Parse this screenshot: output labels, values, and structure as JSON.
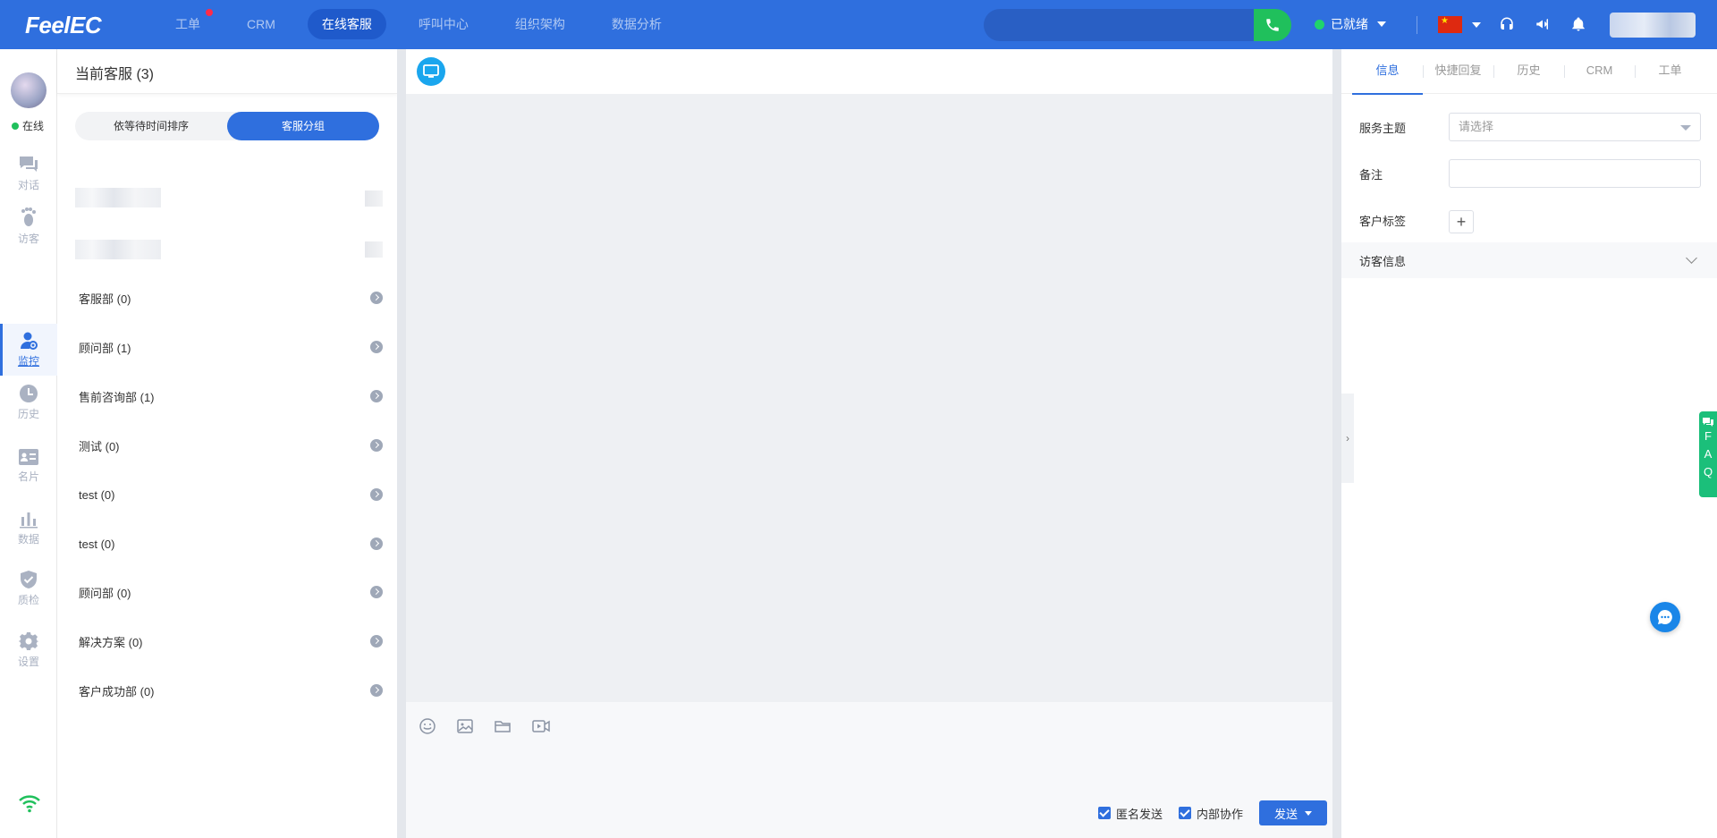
{
  "app": {
    "logo": "FeelEC"
  },
  "nav": {
    "items": [
      {
        "label": "工单",
        "badge": true
      },
      {
        "label": "CRM"
      },
      {
        "label": "在线客服",
        "active": true
      },
      {
        "label": "呼叫中心"
      },
      {
        "label": "组织架构"
      },
      {
        "label": "数据分析"
      }
    ]
  },
  "topbar": {
    "status": "已就绪",
    "status_color": "#20d46b",
    "accent": "#2f6fde"
  },
  "rail": {
    "online": "在线",
    "items": [
      {
        "label": "对话",
        "icon": "chat-icon"
      },
      {
        "label": "访客",
        "icon": "footprint-icon"
      },
      {
        "label": "监控",
        "icon": "monitor-user-icon",
        "active": true
      },
      {
        "label": "历史",
        "icon": "clock-icon"
      },
      {
        "label": "名片",
        "icon": "card-icon"
      },
      {
        "label": "数据",
        "icon": "bar-chart-icon"
      },
      {
        "label": "质检",
        "icon": "shield-check-icon"
      },
      {
        "label": "设置",
        "icon": "gear-icon"
      }
    ]
  },
  "left_panel": {
    "title": "当前客服 (3)",
    "sort_options": [
      "依等待时间排序",
      "客服分组"
    ],
    "groups": [
      "客服部 (0)",
      "顾问部 (1)",
      "售前咨询部 (1)",
      "测试 (0)",
      "test (0)",
      "test (0)",
      "顾问部 (0)",
      "解决方案 (0)",
      "客户成功部 (0)"
    ]
  },
  "chat": {
    "anonymous_label": "匿名发送",
    "internal_label": "内部协作",
    "send_label": "发送"
  },
  "right_panel": {
    "tabs": [
      "信息",
      "快捷回复",
      "历史",
      "CRM",
      "工单"
    ],
    "service_topic_label": "服务主题",
    "service_topic_placeholder": "请选择",
    "remark_label": "备注",
    "customer_tag_label": "客户标签",
    "visitor_info_label": "访客信息"
  },
  "faq": {
    "letters": [
      "F",
      "A",
      "Q"
    ]
  }
}
